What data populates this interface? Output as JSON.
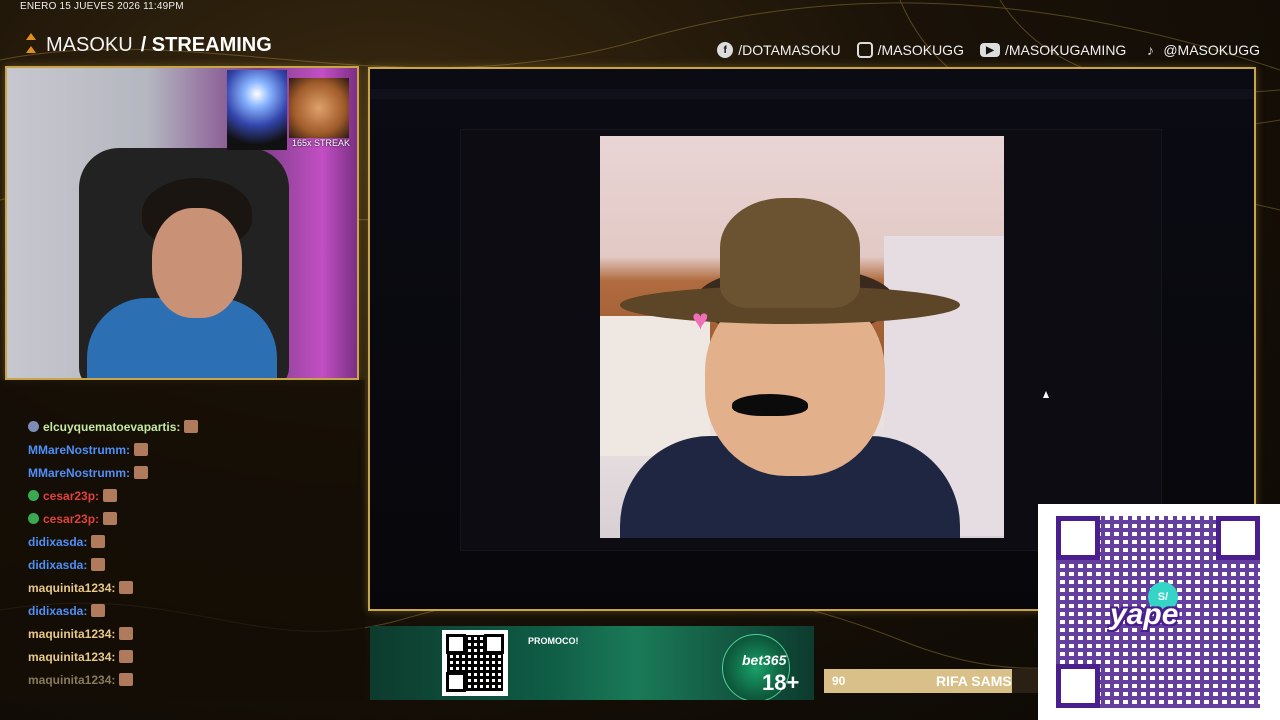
{
  "header": {
    "date": "ENERO 15 JUEVES 2026 11:49PM",
    "brand_light": "MASOKU",
    "brand_bold": "/ STREAMING"
  },
  "socials": [
    {
      "icon": "facebook-icon",
      "label": "/DOTAMASOKU"
    },
    {
      "icon": "instagram-icon",
      "label": "/MASOKUGG"
    },
    {
      "icon": "youtube-icon",
      "label": "/MASOKUGAMING"
    },
    {
      "icon": "tiktok-icon",
      "label": "@MASOKUGG"
    }
  ],
  "webcam": {
    "streak_label": "165x STREAK"
  },
  "chat": {
    "messages": [
      {
        "user": "elcuyquematoevapartis:",
        "color": "#c5e8a0"
      },
      {
        "user": "MMareNostrumm:",
        "color": "#4f8ff7"
      },
      {
        "user": "MMareNostrumm:",
        "color": "#4f8ff7"
      },
      {
        "user": "cesar23p:",
        "color": "#e0413d"
      },
      {
        "user": "cesar23p:",
        "color": "#e0413d"
      },
      {
        "user": "didixasda:",
        "color": "#4f8ff7"
      },
      {
        "user": "didixasda:",
        "color": "#4f8ff7"
      },
      {
        "user": "maquinita1234:",
        "color": "#e8c98a"
      },
      {
        "user": "didixasda:",
        "color": "#4f8ff7"
      },
      {
        "user": "maquinita1234:",
        "color": "#e8c98a"
      },
      {
        "user": "maquinita1234:",
        "color": "#e8c98a"
      },
      {
        "user": "maquinita1234:",
        "color": "#8a7a5a"
      }
    ]
  },
  "promo": {
    "label": "PROMOCO!",
    "logo": "bet365",
    "age": "18+"
  },
  "ticker": {
    "number": "90",
    "text": "RIFA SAMSUN"
  },
  "payment": {
    "brand": "yape",
    "symbol": "S/"
  },
  "colors": {
    "accent_gold": "#c9a54a",
    "brand_orange": "#e2901b",
    "yape_purple": "#4a1e8c"
  }
}
